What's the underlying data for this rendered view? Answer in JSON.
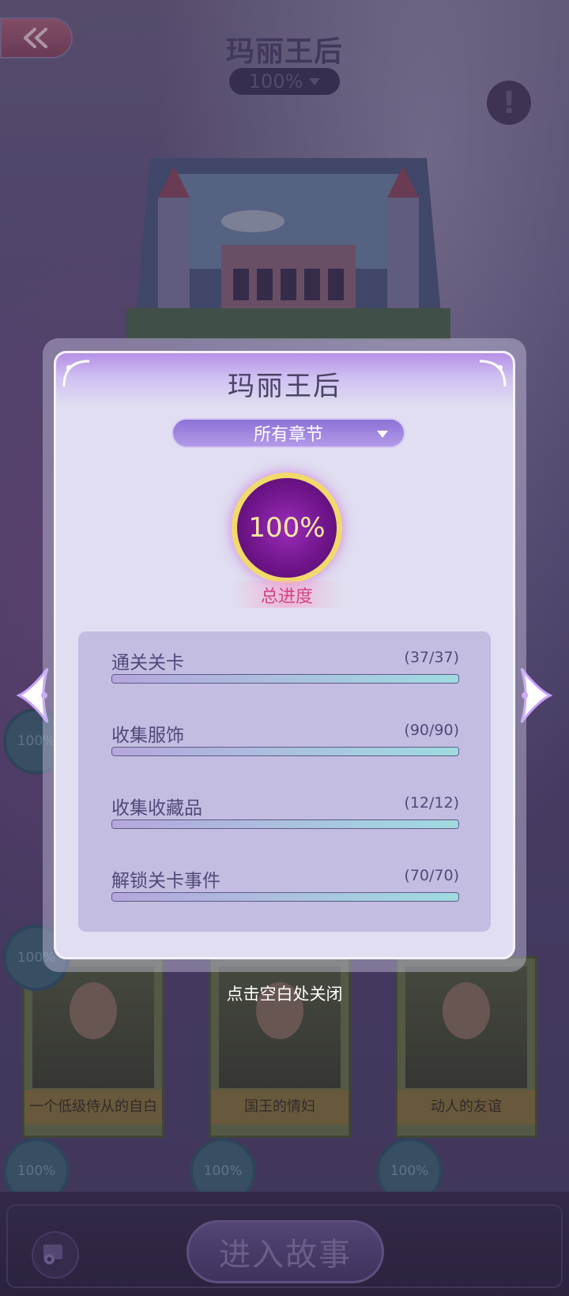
{
  "header": {
    "title": "玛丽王后",
    "progress": "100%"
  },
  "cards": [
    {
      "badge": "100%",
      "label": "一个低级侍从的自白"
    },
    {
      "badge": "100%",
      "label": "国王的情妇"
    },
    {
      "badge": "100%",
      "label": "动人的友谊"
    }
  ],
  "bottom_badges": [
    "100%",
    "100%",
    "100%"
  ],
  "left_badges": [
    "100%",
    "100%"
  ],
  "modal": {
    "title": "玛丽王后",
    "chapter_select": "所有章节",
    "overall_percent": "100%",
    "overall_value": 1.0,
    "overall_label": "总进度",
    "stats": [
      {
        "name": "通关关卡",
        "count": "(37/37)",
        "fraction": 1.0
      },
      {
        "name": "收集服饰",
        "count": "(90/90)",
        "fraction": 1.0
      },
      {
        "name": "收集收藏品",
        "count": "(12/12)",
        "fraction": 1.0
      },
      {
        "name": "解锁关卡事件",
        "count": "(70/70)",
        "fraction": 1.0
      }
    ]
  },
  "close_hint": "点击空白处关闭",
  "bottom": {
    "enter_label": "进入故事"
  },
  "colors": {
    "ring_border": "#f1d96b",
    "ring_fill": "#7a1a98",
    "progress_fill": "#9fdbe0",
    "accent_pink": "#d04488"
  }
}
